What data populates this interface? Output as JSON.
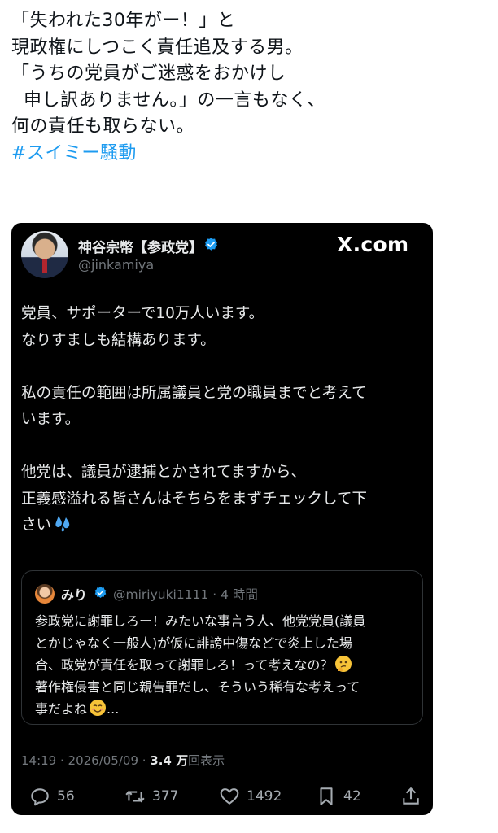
{
  "caption": {
    "lines": [
      "「失われた30年がー！」と",
      "現政権にしつこく責任追及する男。",
      "「うちの党員がご迷惑をおかけし",
      "  申し訳ありません。」の一言もなく、",
      "何の責任も取らない。"
    ],
    "hashtag": "#スイミー騒動"
  },
  "tweet": {
    "author_name": "神谷宗幣【参政党】",
    "author_handle": "@jinkamiya",
    "brand": "X.com",
    "body_lines": [
      "党員、サポーターで10万人います。",
      "なりすましも結構あります。",
      "",
      "私の責任の範囲は所属議員と党の職員までと考えて",
      "います。",
      "",
      "他党は、議員が逮捕とかされてますから、",
      "正義感溢れる皆さんはそちらをまずチェックして下",
      "さい"
    ],
    "body_emoji": "sweat-droplets-emoji",
    "quote": {
      "name": "みり",
      "handle_time": "@miriyuki1111 · 4 時間",
      "lines": [
        "参政党に謝罪しろー！みたいな事言う人、他党党員(議員",
        "とかじゃなく一般人)が仮に誹謗中傷などで炎上した場",
        "合、政党が責任を取って謝罪しろ！って考えなの？",
        "著作権侵害と同じ親告罪だし、そういう稀有な考えって",
        "事だよね"
      ],
      "ellipsis": "...",
      "emoji_line3": "thinking-face-emoji",
      "emoji_line5": "smiling-face-emoji"
    },
    "timestamp": "14:19 · 2026/05/09 · ",
    "views_count": "3.4 万",
    "views_label": "回表示",
    "actions": {
      "replies": "56",
      "reposts": "377",
      "likes": "1492",
      "bookmarks": "42"
    },
    "colors": {
      "card_bg": "#000000",
      "accent": "#1d9bf0",
      "muted": "#71767b"
    }
  }
}
